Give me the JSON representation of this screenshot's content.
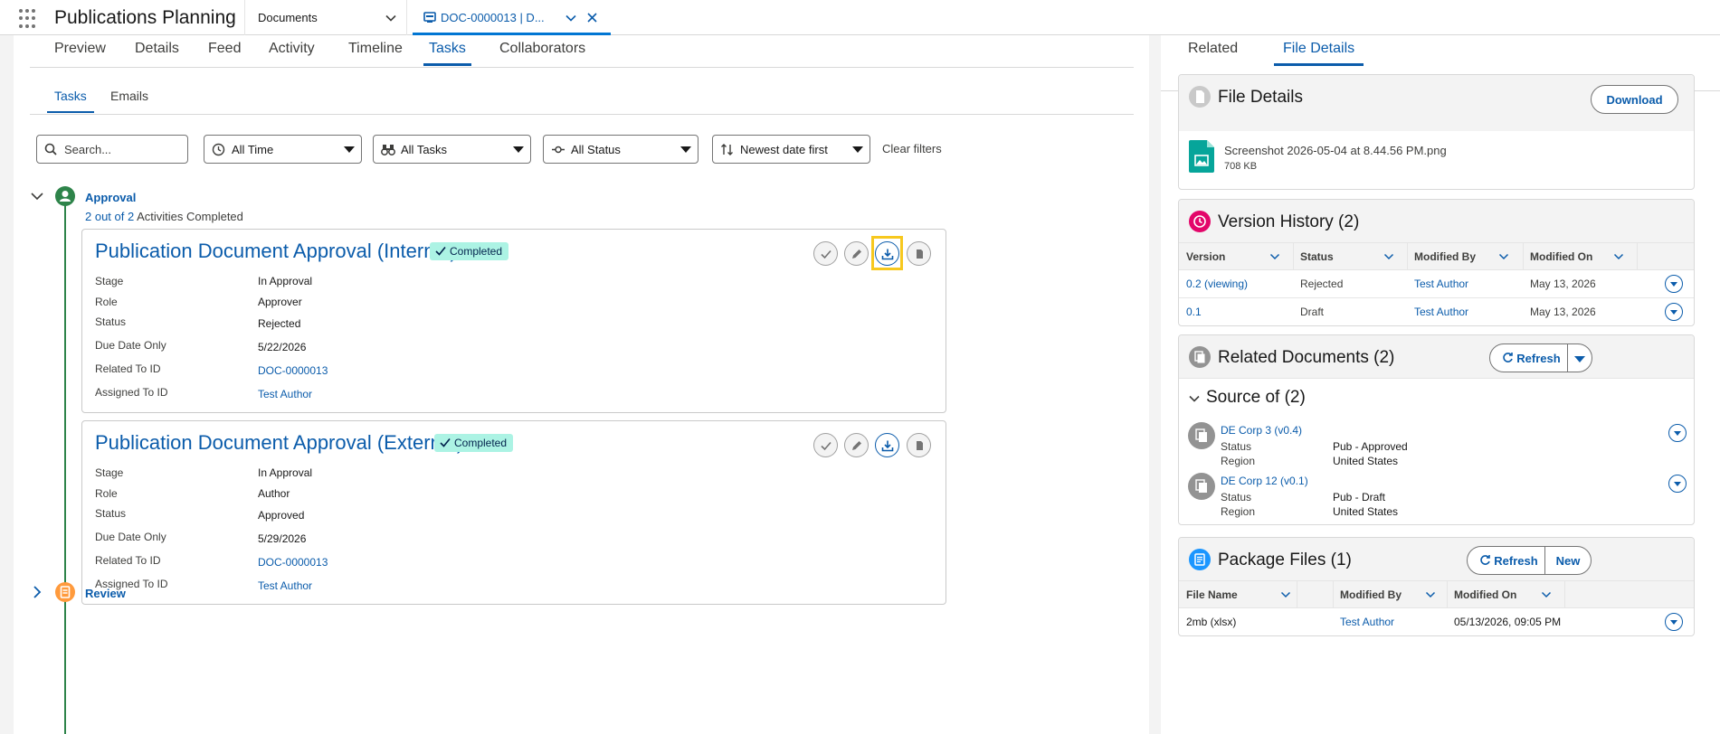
{
  "app": {
    "name": "Publications Planning"
  },
  "navigation": {
    "object_select": "Documents",
    "open_tab": "DOC-0000013 | D..."
  },
  "main_tabs": [
    "Preview",
    "Details",
    "Feed",
    "Activity",
    "Timeline",
    "Tasks",
    "Collaborators"
  ],
  "active_main_tab": "Tasks",
  "sub_tabs": [
    "Tasks",
    "Emails"
  ],
  "filters": {
    "search_placeholder": "Search...",
    "time": "All Time",
    "tasks": "All Tasks",
    "status": "All Status",
    "sort": "Newest date first",
    "clear": "Clear filters"
  },
  "stages": [
    {
      "name": "Approval",
      "progress_count": "2 out of 2",
      "progress_text": "Activities Completed",
      "color": "#2e844a"
    },
    {
      "name": "Review",
      "color": "#ff9a3c"
    }
  ],
  "tasks": [
    {
      "title": "Publication Document Approval (Internal)",
      "badge": "Completed",
      "fields": [
        {
          "label": "Stage",
          "value": "In Approval"
        },
        {
          "label": "Role",
          "value": "Approver"
        },
        {
          "label": "Status",
          "value": "Rejected"
        },
        {
          "label": "Due Date Only",
          "value": "5/22/2026"
        },
        {
          "label": "Related To ID",
          "value": "DOC-0000013"
        },
        {
          "label": "Assigned To ID",
          "value": "Test Author"
        }
      ]
    },
    {
      "title": "Publication Document Approval (External)",
      "badge": "Completed",
      "fields": [
        {
          "label": "Stage",
          "value": "In Approval"
        },
        {
          "label": "Role",
          "value": "Author"
        },
        {
          "label": "Status",
          "value": "Approved"
        },
        {
          "label": "Due Date Only",
          "value": "5/29/2026"
        },
        {
          "label": "Related To ID",
          "value": "DOC-0000013"
        },
        {
          "label": "Assigned To ID",
          "value": "Test Author"
        }
      ]
    }
  ],
  "side_tabs": [
    "Related",
    "File Details"
  ],
  "file_details": {
    "title": "File Details",
    "download": "Download",
    "file_name": "Screenshot 2026-05-04 at 8.44.56 PM.png",
    "file_size": "708 KB"
  },
  "version_history": {
    "title": "Version History (2)",
    "columns": [
      "Version",
      "Status",
      "Modified By",
      "Modified On"
    ],
    "rows": [
      {
        "version": "0.2 (viewing)",
        "status": "Rejected",
        "modified_by": "Test Author",
        "modified_on": "May 13, 2026"
      },
      {
        "version": "0.1",
        "status": "Draft",
        "modified_by": "Test Author",
        "modified_on": "May 13, 2026"
      }
    ]
  },
  "related_documents": {
    "title": "Related Documents (2)",
    "refresh": "Refresh",
    "section": "Source of (2)",
    "status_label": "Status",
    "region_label": "Region",
    "items": [
      {
        "name": "DE Corp 3 (v0.4)",
        "status": "Pub - Approved",
        "region": "United States"
      },
      {
        "name": "DE Corp 12 (v0.1)",
        "status": "Pub - Draft",
        "region": "United States"
      }
    ]
  },
  "package_files": {
    "title": "Package Files (1)",
    "refresh": "Refresh",
    "new": "New",
    "columns": [
      "File Name",
      "Modified By",
      "Modified On"
    ],
    "rows": [
      {
        "file_name": "2mb (xlsx)",
        "modified_by": "Test Author",
        "modified_on": "05/13/2026, 09:05 PM"
      }
    ]
  }
}
